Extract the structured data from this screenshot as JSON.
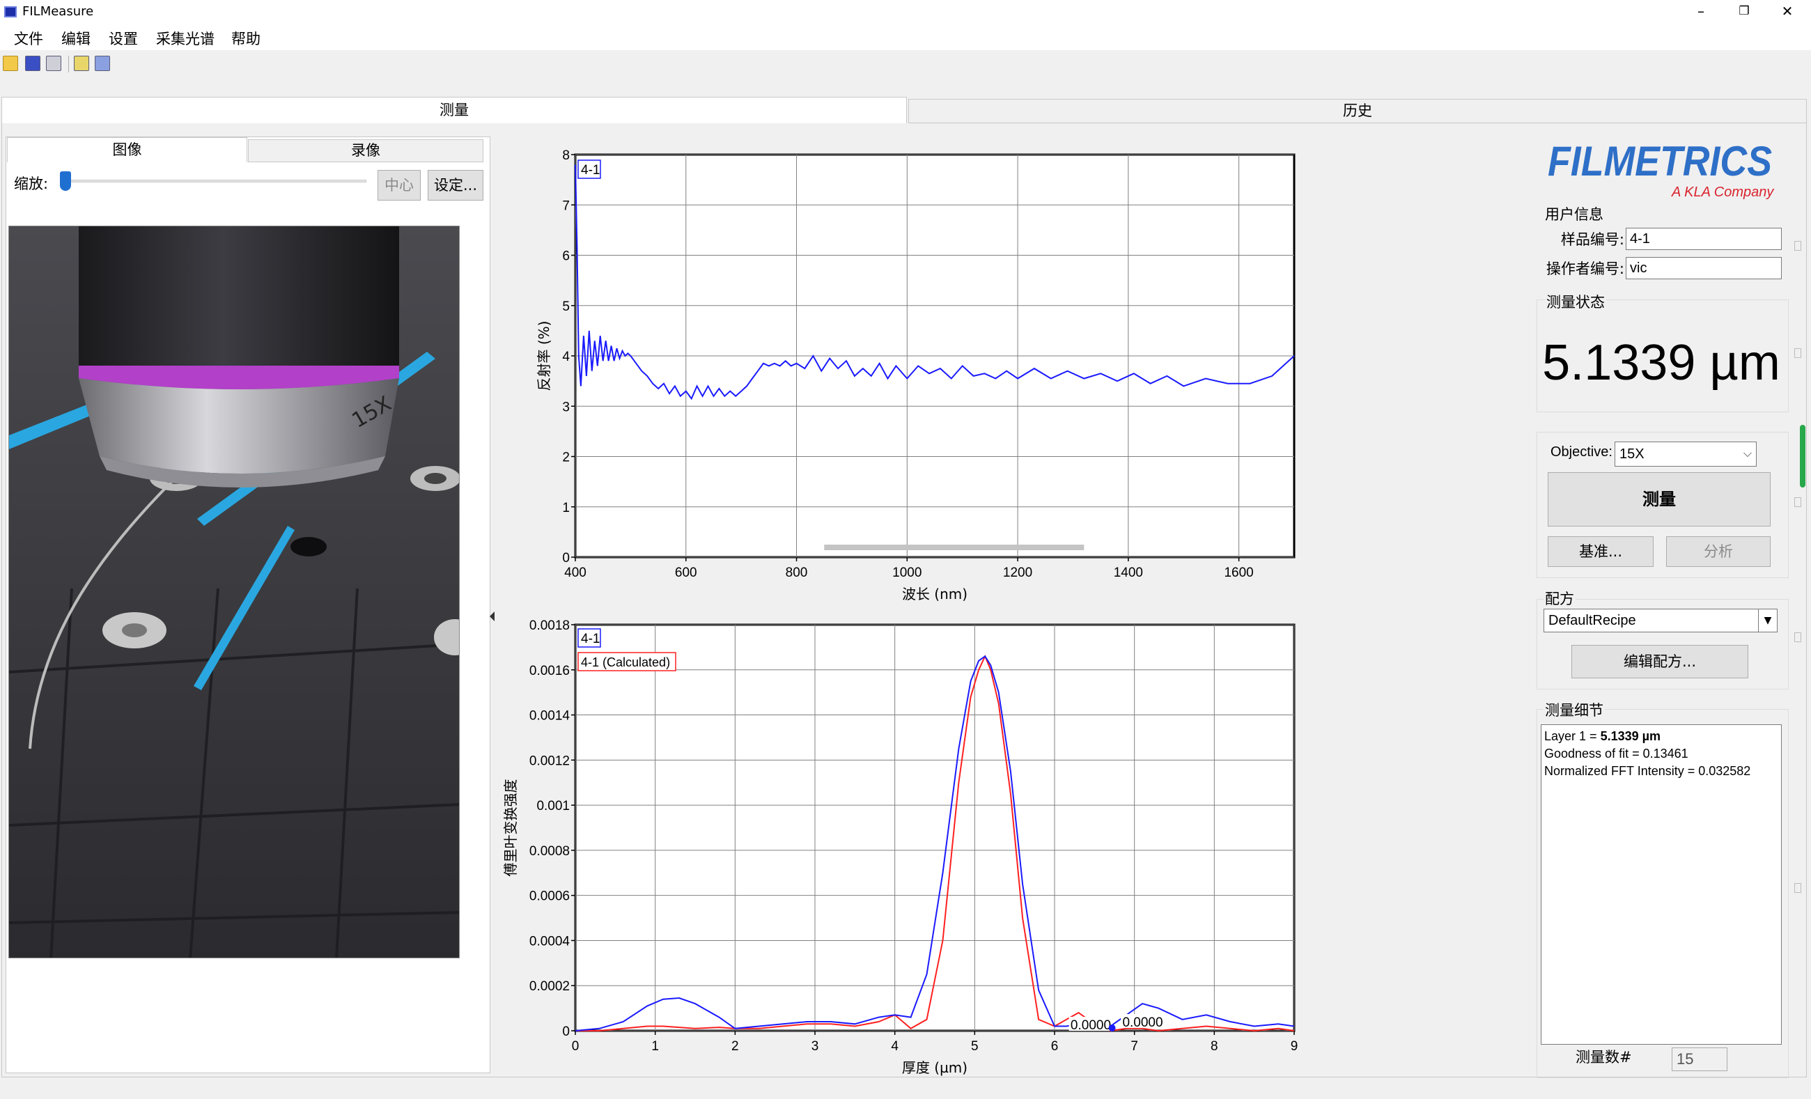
{
  "window": {
    "title": "FILMeasure",
    "minimize": "–",
    "restore": "❐",
    "close": "✕"
  },
  "menu": [
    "文件",
    "编辑",
    "设置",
    "采集光谱",
    "帮助"
  ],
  "toolbar": [
    "open-folder-icon",
    "save-icon",
    "print-icon",
    "image-icon",
    "copy-image-icon"
  ],
  "main_tabs": {
    "measure": "测量",
    "history": "历史"
  },
  "left_panel": {
    "tab_image": "图像",
    "tab_video": "录像",
    "zoom_label": "缩放:",
    "zoom_level": 0,
    "center_button": "中心",
    "settings_button": "设定..."
  },
  "reflectance_chart": {
    "series_label": "4-1",
    "xlabel": "波长 (nm)",
    "ylabel": "反射率 (%)",
    "x_ticks": [
      "400",
      "600",
      "800",
      "1000",
      "1200",
      "1400",
      "1600"
    ],
    "y_ticks": [
      "0",
      "1",
      "2",
      "3",
      "4",
      "5",
      "6",
      "7",
      "8"
    ]
  },
  "fft_chart": {
    "series_label": "4-1",
    "calc_label": "4-1 (Calculated)",
    "xlabel": "厚度 (µm)",
    "ylabel": "傅里叶变换强度",
    "x_ticks": [
      "0",
      "1",
      "2",
      "3",
      "4",
      "5",
      "6",
      "7",
      "8",
      "9"
    ],
    "y_ticks": [
      "0",
      "0.0002",
      "0.0004",
      "0.0006",
      "0.0008",
      "0.001",
      "0.0012",
      "0.0014",
      "0.0016",
      "0.0018"
    ],
    "marker_red": "0.0000",
    "marker_blue": "0.0000"
  },
  "chart_data": [
    {
      "type": "line",
      "xlabel": "波长 (nm)",
      "ylabel": "反射率 (%)",
      "xlim": [
        400,
        1700
      ],
      "ylim": [
        0,
        8
      ],
      "series": [
        {
          "name": "4-1",
          "x": [
            400,
            403,
            406,
            410,
            415,
            420,
            425,
            430,
            435,
            440,
            445,
            450,
            455,
            460,
            465,
            470,
            475,
            480,
            485,
            490,
            495,
            500,
            510,
            520,
            530,
            540,
            550,
            560,
            570,
            580,
            590,
            600,
            610,
            620,
            630,
            640,
            650,
            660,
            670,
            680,
            690,
            700,
            710,
            720,
            730,
            740,
            750,
            760,
            770,
            780,
            790,
            800,
            815,
            830,
            845,
            860,
            875,
            890,
            905,
            920,
            935,
            950,
            965,
            980,
            1000,
            1020,
            1040,
            1060,
            1080,
            1100,
            1120,
            1140,
            1160,
            1180,
            1200,
            1230,
            1260,
            1290,
            1320,
            1350,
            1380,
            1410,
            1440,
            1470,
            1500,
            1540,
            1580,
            1620,
            1660,
            1700
          ],
          "values": [
            7.8,
            6.2,
            4.0,
            3.4,
            4.4,
            3.6,
            4.5,
            3.7,
            4.3,
            3.8,
            4.4,
            3.9,
            4.3,
            3.9,
            4.2,
            3.9,
            4.15,
            3.95,
            4.1,
            4.0,
            4.05,
            4.0,
            3.85,
            3.7,
            3.6,
            3.45,
            3.35,
            3.45,
            3.25,
            3.4,
            3.2,
            3.3,
            3.15,
            3.4,
            3.2,
            3.4,
            3.2,
            3.35,
            3.2,
            3.3,
            3.2,
            3.3,
            3.4,
            3.55,
            3.7,
            3.85,
            3.8,
            3.85,
            3.8,
            3.9,
            3.8,
            3.85,
            3.75,
            4.0,
            3.7,
            3.95,
            3.75,
            3.9,
            3.6,
            3.75,
            3.6,
            3.85,
            3.55,
            3.8,
            3.55,
            3.8,
            3.65,
            3.75,
            3.55,
            3.8,
            3.6,
            3.65,
            3.55,
            3.7,
            3.55,
            3.75,
            3.55,
            3.7,
            3.55,
            3.65,
            3.5,
            3.65,
            3.45,
            3.6,
            3.4,
            3.55,
            3.45,
            3.45,
            3.6,
            4.0
          ]
        }
      ]
    },
    {
      "type": "line",
      "xlabel": "厚度 (µm)",
      "ylabel": "傅里叶变换强度",
      "xlim": [
        0,
        9
      ],
      "ylim": [
        0,
        0.0019
      ],
      "x": [
        0,
        0.3,
        0.6,
        0.9,
        1.1,
        1.3,
        1.5,
        1.8,
        2.0,
        2.3,
        2.6,
        2.9,
        3.2,
        3.5,
        3.8,
        4.0,
        4.2,
        4.4,
        4.6,
        4.8,
        4.95,
        5.05,
        5.13,
        5.2,
        5.3,
        5.45,
        5.6,
        5.8,
        6.0,
        6.15,
        6.3,
        6.5,
        6.7,
        6.9,
        7.1,
        7.3,
        7.6,
        7.9,
        8.2,
        8.5,
        8.8,
        9.0
      ],
      "series": [
        {
          "name": "4-1",
          "values": [
            0.0,
            1e-05,
            4e-05,
            0.00011,
            0.00014,
            0.000145,
            0.00012,
            6e-05,
            1e-05,
            2e-05,
            3e-05,
            4e-05,
            4e-05,
            3e-05,
            6e-05,
            7e-05,
            6e-05,
            0.00025,
            0.0007,
            0.00125,
            0.00155,
            0.00164,
            0.00166,
            0.00162,
            0.0015,
            0.00115,
            0.00065,
            0.00018,
            2e-05,
            2e-05,
            3e-05,
            2e-05,
            2e-05,
            7e-05,
            0.00012,
            0.0001,
            5e-05,
            7e-05,
            4e-05,
            2e-05,
            3e-05,
            2e-05
          ]
        },
        {
          "name": "4-1 (Calculated)",
          "values": [
            0.0,
            0.0,
            1e-05,
            2e-05,
            2e-05,
            1.5e-05,
            1e-05,
            1.5e-05,
            1e-05,
            1e-05,
            2e-05,
            3e-05,
            3e-05,
            2e-05,
            4e-05,
            7e-05,
            1e-05,
            5e-05,
            0.0004,
            0.0011,
            0.00148,
            0.0016,
            0.00166,
            0.0016,
            0.00145,
            0.00105,
            0.0005,
            5e-05,
            2e-05,
            5e-05,
            8e-05,
            3e-05,
            0.0,
            1e-05,
            1e-05,
            0.0,
            1e-05,
            2e-05,
            1e-05,
            0.0,
            1e-05,
            0.0
          ]
        }
      ]
    }
  ],
  "right_panel": {
    "logo_main": "FILMETRICS",
    "logo_sub": "A KLA Company",
    "user_info_label": "用户信息",
    "sample_id_label": "样品编号:",
    "sample_id_value": "4-1",
    "operator_label": "操作者编号:",
    "operator_value": "vic",
    "status_label": "测量状态",
    "thickness": "5.1339 µm",
    "objective_label": "Objective:",
    "objective_value": "15X",
    "measure_button": "测量",
    "baseline_button": "基准...",
    "analyze_button": "分析",
    "recipe_label": "配方",
    "recipe_value": "DefaultRecipe",
    "edit_recipe_button": "编辑配方...",
    "details_label": "测量细节",
    "details": {
      "layer_prefix": "Layer 1 = ",
      "layer_value": "5.1339 µm",
      "goodness": "Goodness of fit = 0.13461",
      "fft_intensity": "Normalized FFT Intensity = 0.032582"
    },
    "count_label": "测量数#",
    "count_value": "15"
  },
  "colors": {
    "series_blue": "#1a1aff",
    "series_red": "#ff2020",
    "logo_blue": "#2e6fc7",
    "logo_red": "#d9232d"
  }
}
